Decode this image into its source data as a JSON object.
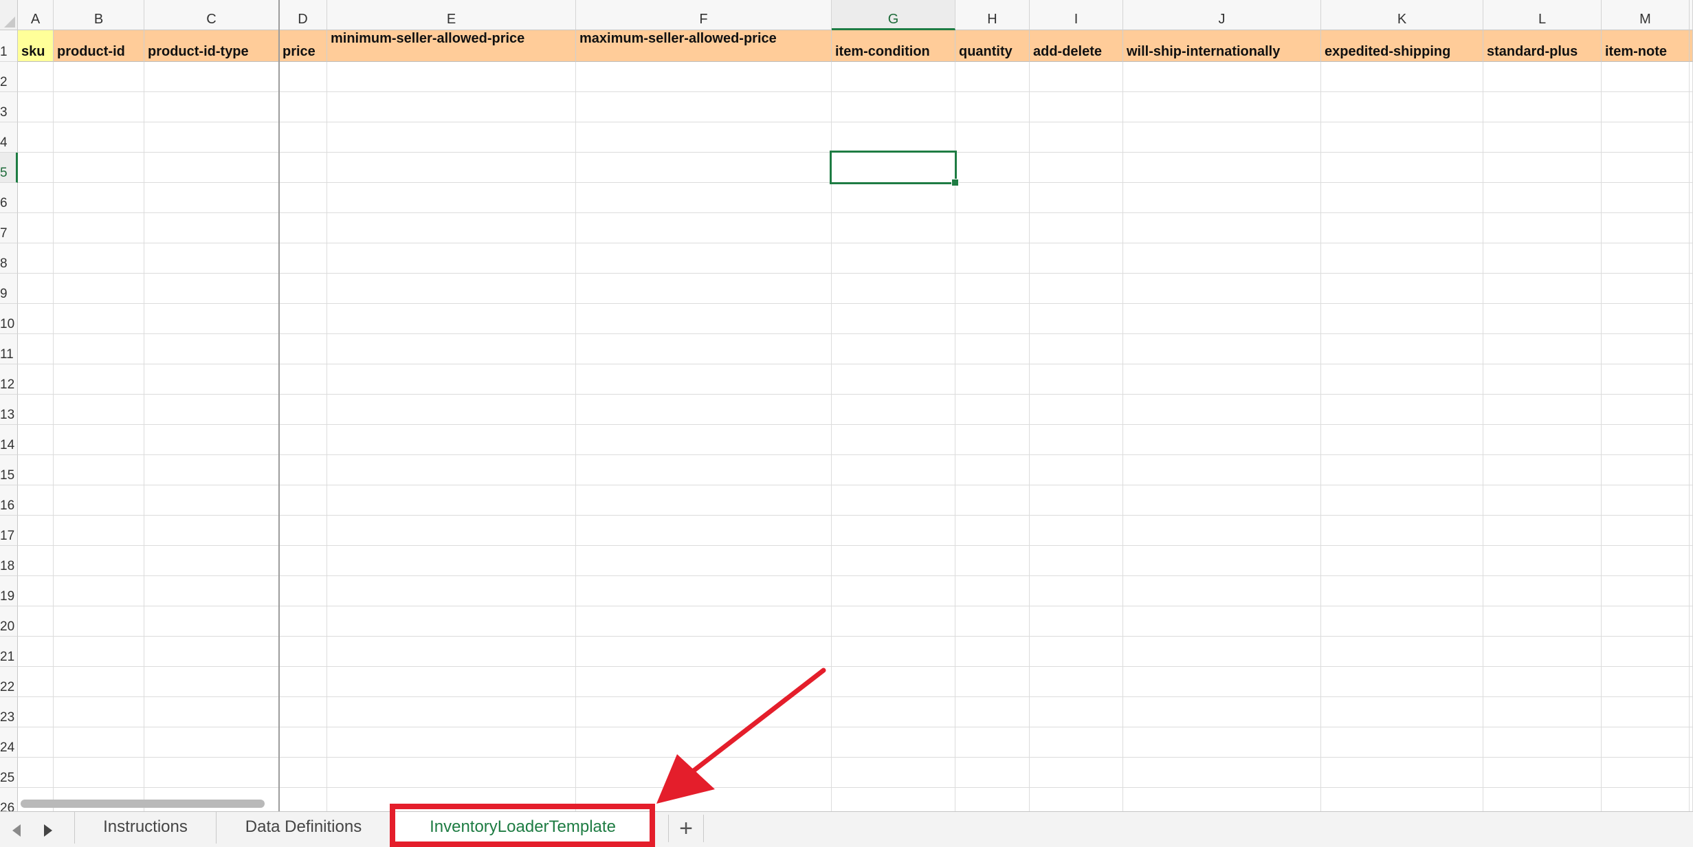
{
  "spreadsheet": {
    "columns": [
      {
        "letter": "A",
        "header": "sku",
        "header_bg": "#ffff99",
        "selected": false,
        "top_label": false
      },
      {
        "letter": "B",
        "header": "product-id",
        "header_bg": "#ffcc99",
        "selected": false,
        "top_label": false
      },
      {
        "letter": "C",
        "header": "product-id-type",
        "header_bg": "#ffcc99",
        "selected": false,
        "top_label": false
      },
      {
        "letter": "D",
        "header": "price",
        "header_bg": "#ffcc99",
        "selected": false,
        "top_label": false
      },
      {
        "letter": "E",
        "header": "minimum-seller-allowed-price",
        "header_bg": "#ffcc99",
        "selected": false,
        "top_label": true
      },
      {
        "letter": "F",
        "header": "maximum-seller-allowed-price",
        "header_bg": "#ffcc99",
        "selected": false,
        "top_label": true
      },
      {
        "letter": "G",
        "header": "item-condition",
        "header_bg": "#ffcc99",
        "selected": true,
        "top_label": false
      },
      {
        "letter": "H",
        "header": "quantity",
        "header_bg": "#ffcc99",
        "selected": false,
        "top_label": false
      },
      {
        "letter": "I",
        "header": "add-delete",
        "header_bg": "#ffcc99",
        "selected": false,
        "top_label": false
      },
      {
        "letter": "J",
        "header": "will-ship-internationally",
        "header_bg": "#ffcc99",
        "selected": false,
        "top_label": false
      },
      {
        "letter": "K",
        "header": "expedited-shipping",
        "header_bg": "#ffcc99",
        "selected": false,
        "top_label": false
      },
      {
        "letter": "L",
        "header": "standard-plus",
        "header_bg": "#ffcc99",
        "selected": false,
        "top_label": false
      },
      {
        "letter": "M",
        "header": "item-note",
        "header_bg": "#ffcc99",
        "selected": false,
        "top_label": false
      },
      {
        "letter": "",
        "header": "",
        "header_bg": "#ffcc99",
        "selected": false,
        "top_label": false
      }
    ],
    "rows": [
      "1",
      "2",
      "3",
      "4",
      "5",
      "6",
      "7",
      "8",
      "9",
      "10",
      "11",
      "12",
      "13",
      "14",
      "15",
      "16",
      "17",
      "18",
      "19",
      "20",
      "21",
      "22",
      "23",
      "24",
      "25",
      "26"
    ],
    "selected_row": "5",
    "accent_color": "#1e7c43"
  },
  "tabs": {
    "prev_icon": "triangle-left-icon",
    "next_icon": "triangle-right-icon",
    "items": [
      {
        "label": "Instructions",
        "active": false
      },
      {
        "label": "Data Definitions",
        "active": false
      },
      {
        "label": "InventoryLoaderTemplate",
        "active": true
      }
    ],
    "add_label": "+"
  },
  "annotation": {
    "color": "#e41e2b",
    "target": "InventoryLoaderTemplate"
  }
}
